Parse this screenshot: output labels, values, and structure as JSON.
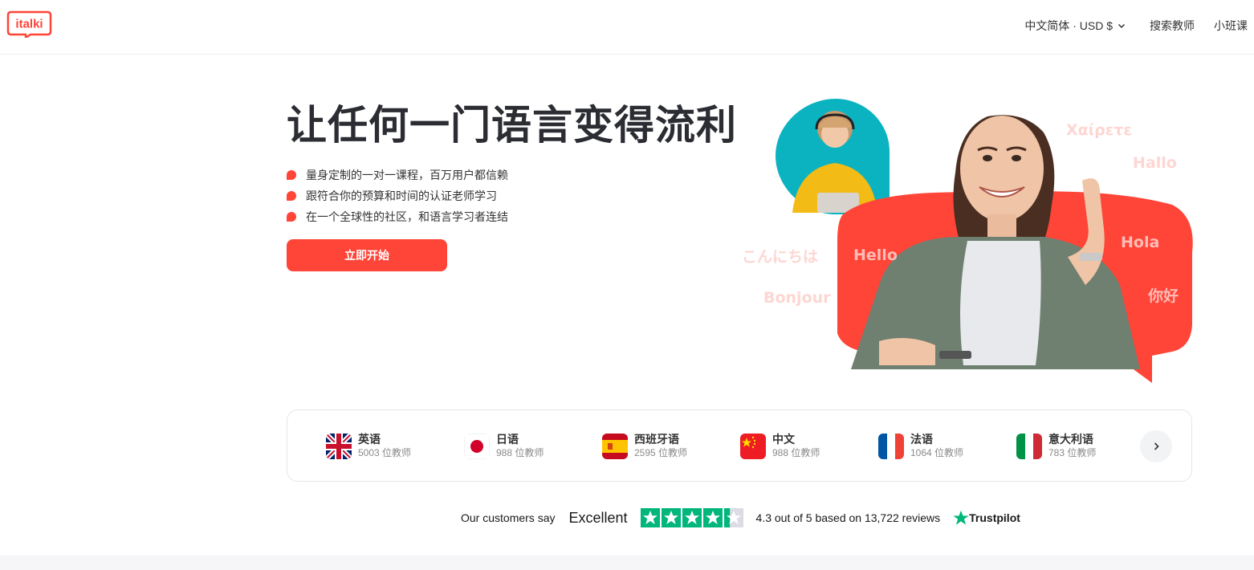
{
  "brand": {
    "logo_text": "italki",
    "accent_color": "#ff4438"
  },
  "header": {
    "language_currency": "中文简体 · USD $",
    "nav_links": [
      "搜索教师",
      "小班课"
    ]
  },
  "hero": {
    "title": "让任何一门语言变得流利",
    "bullets": [
      "量身定制的一对一课程，百万用户都信赖",
      "跟符合你的预算和时间的认证老师学习",
      "在一个全球性的社区，和语言学习者连结"
    ],
    "cta_label": "立即开始",
    "greetings": [
      "Χαίρετε",
      "Hallo",
      "こんにちは",
      "Hello",
      "Hola",
      "Bonjour",
      "你好"
    ]
  },
  "languages": [
    {
      "name": "英语",
      "count": "5003 位教师",
      "flag": "uk-flag"
    },
    {
      "name": "日语",
      "count": "988 位教师",
      "flag": "japan-flag"
    },
    {
      "name": "西班牙语",
      "count": "2595 位教师",
      "flag": "spain-flag"
    },
    {
      "name": "中文",
      "count": "988 位教师",
      "flag": "china-flag"
    },
    {
      "name": "法语",
      "count": "1064 位教师",
      "flag": "france-flag"
    },
    {
      "name": "意大利语",
      "count": "783 位教师",
      "flag": "italy-flag"
    }
  ],
  "trustpilot": {
    "intro": "Our customers say",
    "rating_word": "Excellent",
    "stars": 4.3,
    "summary": "4.3 out of 5 based on 13,722 reviews",
    "brand": "Trustpilot",
    "star_color": "#00b67a"
  }
}
